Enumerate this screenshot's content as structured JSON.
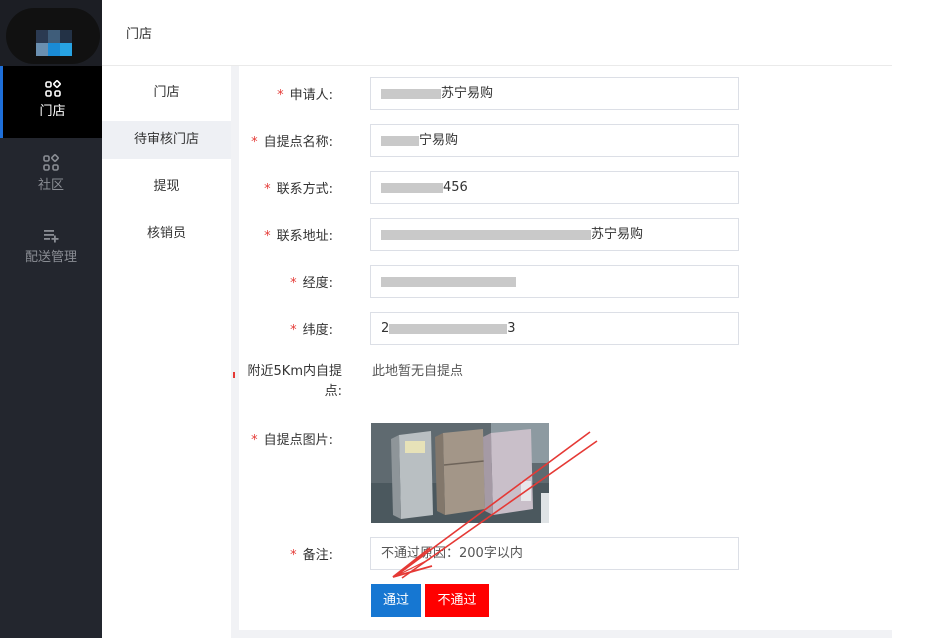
{
  "nav": {
    "items": [
      {
        "label": "门店",
        "icon": "grid-icon",
        "active": true
      },
      {
        "label": "社区",
        "icon": "grid-icon",
        "active": false
      },
      {
        "label": "配送管理",
        "icon": "playlist-add-icon",
        "active": false
      }
    ]
  },
  "topbar": {
    "title": "门店"
  },
  "submenu": {
    "items": [
      {
        "label": "门店",
        "active": false
      },
      {
        "label": "待审核门店",
        "active": true
      },
      {
        "label": "提现",
        "active": false
      },
      {
        "label": "核销员",
        "active": false
      }
    ]
  },
  "form": {
    "applicant": {
      "label": "申请人:",
      "value": "苏宁易购"
    },
    "pickup_name": {
      "label": "自提点名称:",
      "value": "宁易购"
    },
    "contact": {
      "label": "联系方式:",
      "value": "456"
    },
    "address": {
      "label": "联系地址:",
      "value": "苏宁易购"
    },
    "longitude": {
      "label": "经度:",
      "value": ""
    },
    "latitude": {
      "label": "纬度:",
      "value": "2",
      "value_end": "3"
    },
    "nearby": {
      "label": "附近5Km内自提点:",
      "value": "此地暂无自提点"
    },
    "photo": {
      "label": "自提点图片:"
    },
    "remark": {
      "label": "备注:",
      "placeholder": "不通过原因：200字以内"
    }
  },
  "buttons": {
    "approve": "通过",
    "reject": "不通过"
  },
  "colors": {
    "primary": "#1677d2",
    "danger": "#ff0000",
    "nav_bg": "#23262e",
    "required": "#e53935",
    "annotation": "#e53935"
  }
}
